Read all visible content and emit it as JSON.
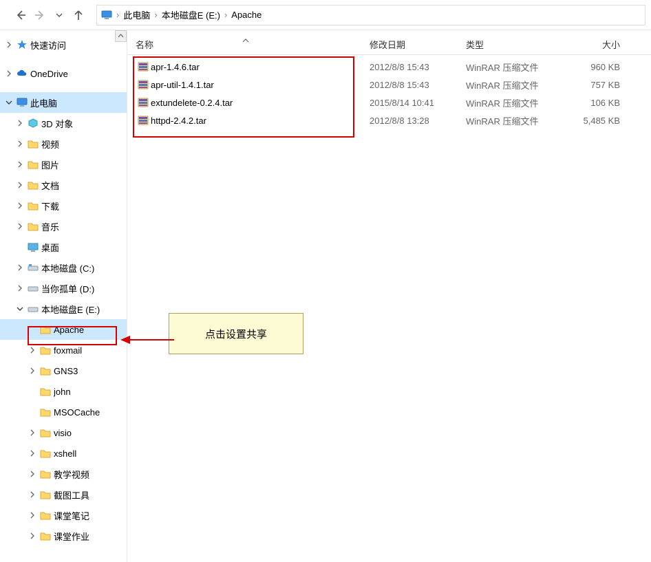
{
  "breadcrumb": {
    "root": "此电脑",
    "drive": "本地磁盘E (E:)",
    "folder": "Apache"
  },
  "columns": {
    "name": "名称",
    "date": "修改日期",
    "type": "类型",
    "size": "大小"
  },
  "files": [
    {
      "name": "apr-1.4.6.tar",
      "date": "2012/8/8 15:43",
      "type": "WinRAR 压缩文件",
      "size": "960 KB"
    },
    {
      "name": "apr-util-1.4.1.tar",
      "date": "2012/8/8 15:43",
      "type": "WinRAR 压缩文件",
      "size": "757 KB"
    },
    {
      "name": "extundelete-0.2.4.tar",
      "date": "2015/8/14 10:41",
      "type": "WinRAR 压缩文件",
      "size": "106 KB"
    },
    {
      "name": "httpd-2.4.2.tar",
      "date": "2012/8/8 13:28",
      "type": "WinRAR 压缩文件",
      "size": "5,485 KB"
    }
  ],
  "tree": {
    "quick_access": "快速访问",
    "onedrive": "OneDrive",
    "this_pc": "此电脑",
    "pc_children": {
      "objects3d": "3D 对象",
      "videos": "视频",
      "pictures": "图片",
      "documents": "文档",
      "downloads": "下载",
      "music": "音乐",
      "desktop": "桌面",
      "drive_c": "本地磁盘 (C:)",
      "drive_d": "当你孤单 (D:)",
      "drive_e": "本地磁盘E (E:)"
    },
    "e_children": {
      "apache": "Apache",
      "foxmail": "foxmail",
      "gns3": "GNS3",
      "john": "john",
      "msocache": "MSOCache",
      "visio": "visio",
      "xshell": "xshell",
      "teach_video": "教学视频",
      "screenshot_tool": "截图工具",
      "class_notes": "课堂笔记",
      "class_work": "课堂作业"
    }
  },
  "callout": "点击设置共享"
}
